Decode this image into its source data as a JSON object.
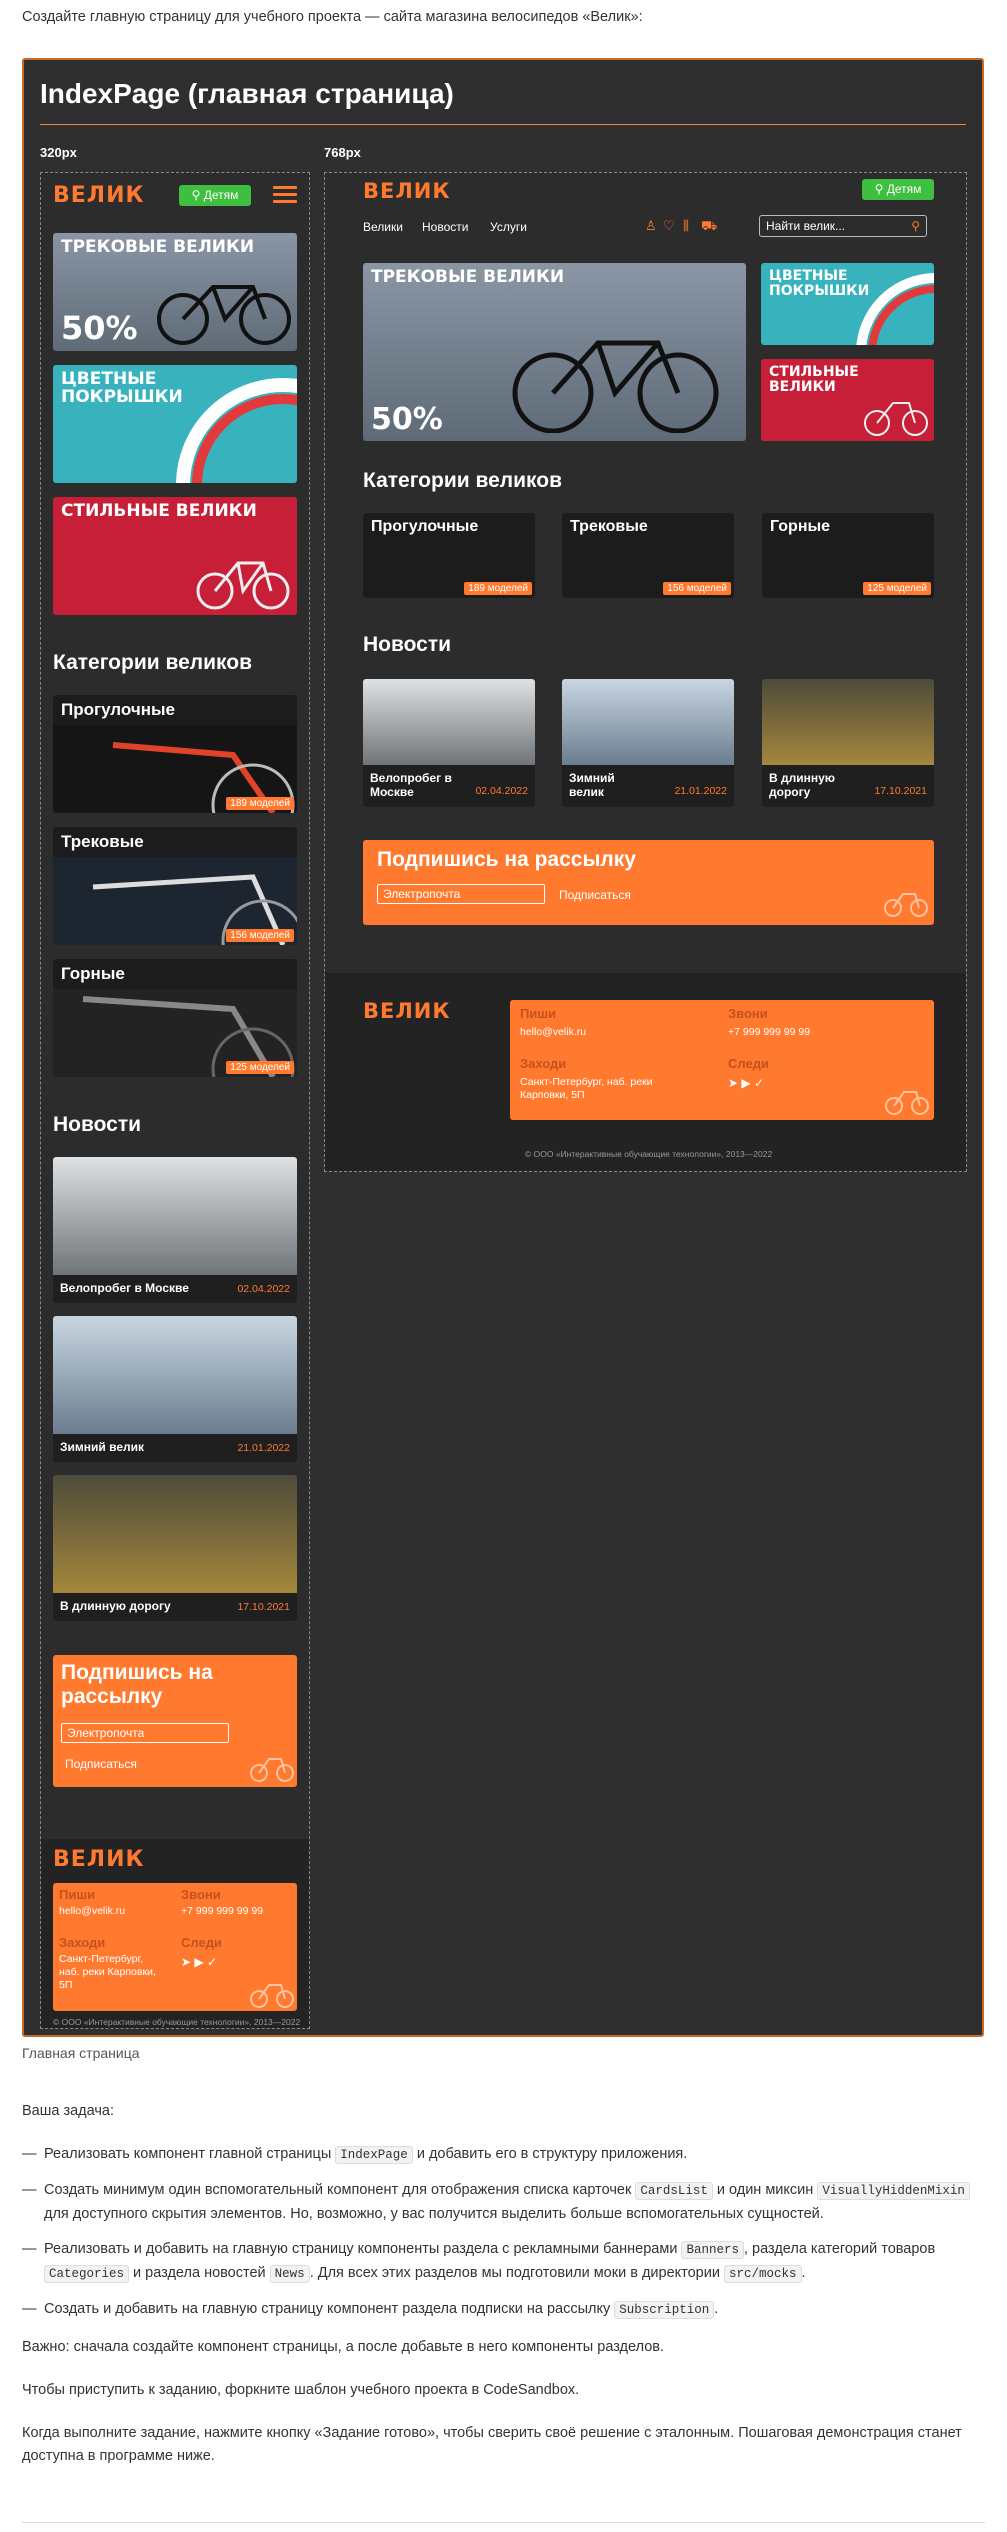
{
  "intro": "Создайте главную страницу для учебного проекта — сайта магазина велосипедов «Велик»:",
  "panel": {
    "title": "IndexPage (главная страница)",
    "label_320": "320px",
    "label_768": "768px"
  },
  "mock": {
    "logo": "ВЕЛИК",
    "kids_button": "Детям",
    "nav": [
      "Велики",
      "Новости",
      "Услуги"
    ],
    "search_placeholder": "Найти велик...",
    "banners": {
      "track": "ТРЕКОВЫЕ ВЕЛИКИ",
      "track_percent": "50%",
      "tires": "ЦВЕТНЫЕ ПОКРЫШКИ",
      "stylish": "СТИЛЬНЫЕ ВЕЛИКИ"
    },
    "categories_title": "Категории великов",
    "categories": [
      {
        "name": "Прогулочные",
        "count": "189 моделей"
      },
      {
        "name": "Трековые",
        "count": "156 моделей"
      },
      {
        "name": "Горные",
        "count": "125 моделей"
      }
    ],
    "news_title": "Новости",
    "news": [
      {
        "title": "Велопробег в Москве",
        "date": "02.04.2022"
      },
      {
        "title": "Зимний велик",
        "date": "21.01.2022"
      },
      {
        "title": "В длинную дорогу",
        "date": "17.10.2021"
      }
    ],
    "subscribe": {
      "title": "Подпишись на рассылку",
      "input_placeholder": "Электропочта",
      "button": "Подписаться"
    },
    "footer": {
      "write_label": "Пиши",
      "write_value": "hello@velik.ru",
      "call_label": "Звони",
      "call_value": "+7 999 999 99 99",
      "visit_label": "Заходи",
      "visit_value": "Санкт-Петербург, наб. реки Карповки, 5П",
      "follow_label": "Следи",
      "copyright": "© ООО «Интерактивные обучающие технологии», 2013—2022"
    }
  },
  "caption": "Главная страница",
  "task": {
    "heading": "Ваша задача:",
    "items": [
      {
        "a": "Реализовать компонент главной страницы ",
        "code1": "IndexPage",
        "b": " и добавить его в структуру приложения."
      },
      {
        "a": "Создать минимум один вспомогательный компонент для отображения списка карточек ",
        "code1": "CardsList",
        "b": " и один миксин ",
        "code2": "VisuallyHiddenMixin",
        "c": " для доступного скрытия элементов. Но, возможно, у вас получится выделить больше вспомогательных сущностей."
      },
      {
        "a": "Реализовать и добавить на главную страницу компоненты раздела с рекламными баннерами ",
        "code1": "Banners",
        "b": ", раздела категорий товаров ",
        "code2": "Categories",
        "c": " и раздела новостей ",
        "code3": "News",
        "d": ". Для всех этих разделов мы подготовили моки в директории ",
        "code4": "src/mocks",
        "e": "."
      },
      {
        "a": "Создать и добавить на главную страницу компонент раздела подписки на рассылку ",
        "code1": "Subscription",
        "b": "."
      }
    ],
    "note": "Важно: сначала создайте компонент страницы, а после добавьте в него компоненты разделов.",
    "fork": "Чтобы приступить к заданию, форкните шаблон учебного проекта в CodeSandbox.",
    "done": "Когда выполните задание, нажмите кнопку «Задание готово», чтобы сверить своё решение с эталонным. Пошаговая демонстрация станет доступна в программе ниже."
  }
}
